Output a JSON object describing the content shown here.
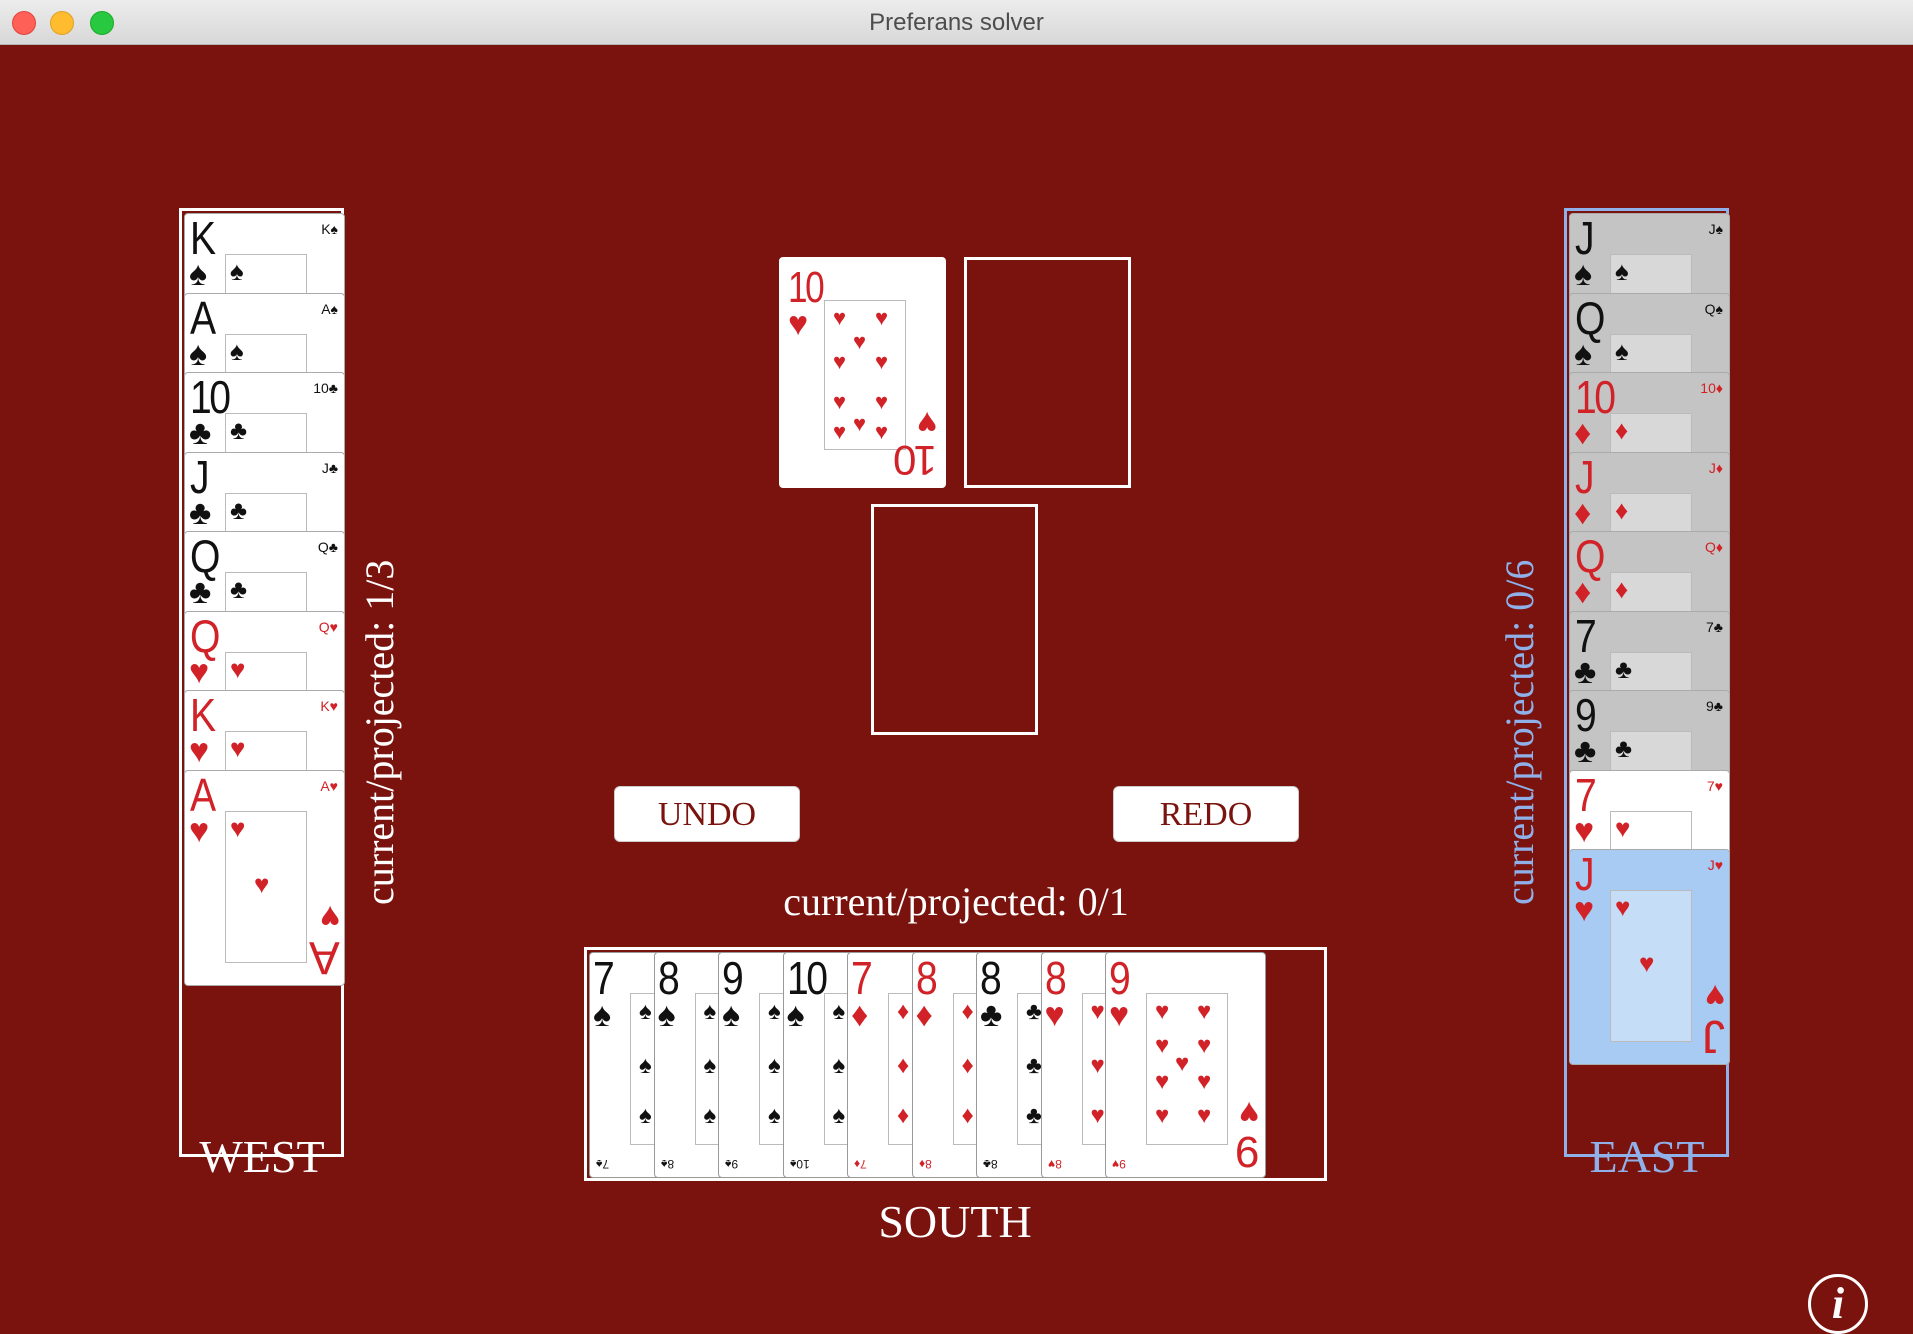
{
  "window": {
    "title": "Preferans solver"
  },
  "colors": {
    "table": "#7a130e",
    "east_accent": "#8fb0e8",
    "red_suit": "#d12228"
  },
  "west": {
    "label": "WEST",
    "score": "current/projected: 1/3",
    "cards": [
      {
        "rank": "K",
        "suit": "♠",
        "color": "black",
        "face": "K"
      },
      {
        "rank": "A",
        "suit": "♠",
        "color": "black",
        "face": "A"
      },
      {
        "rank": "10",
        "suit": "♣",
        "color": "black",
        "face": "10"
      },
      {
        "rank": "J",
        "suit": "♣",
        "color": "black",
        "face": "J"
      },
      {
        "rank": "Q",
        "suit": "♣",
        "color": "black",
        "face": "Q"
      },
      {
        "rank": "Q",
        "suit": "♥",
        "color": "red",
        "face": "Q"
      },
      {
        "rank": "K",
        "suit": "♥",
        "color": "red",
        "face": "K"
      },
      {
        "rank": "A",
        "suit": "♥",
        "color": "red",
        "face": "A"
      }
    ]
  },
  "east": {
    "label": "EAST",
    "score": "current/projected: 0/6",
    "cards": [
      {
        "rank": "J",
        "suit": "♠",
        "color": "black",
        "state": "dim"
      },
      {
        "rank": "Q",
        "suit": "♠",
        "color": "black",
        "state": "dim"
      },
      {
        "rank": "10",
        "suit": "♦",
        "color": "red",
        "state": "dim"
      },
      {
        "rank": "J",
        "suit": "♦",
        "color": "red",
        "state": "dim"
      },
      {
        "rank": "Q",
        "suit": "♦",
        "color": "red",
        "state": "dim"
      },
      {
        "rank": "7",
        "suit": "♣",
        "color": "black",
        "state": "dim"
      },
      {
        "rank": "9",
        "suit": "♣",
        "color": "black",
        "state": "dim"
      },
      {
        "rank": "7",
        "suit": "♥",
        "color": "red",
        "state": "normal"
      },
      {
        "rank": "J",
        "suit": "♥",
        "color": "red",
        "state": "selected"
      }
    ]
  },
  "south": {
    "label": "SOUTH",
    "score": "current/projected: 0/1",
    "cards": [
      {
        "rank": "7",
        "suit": "♠",
        "color": "black"
      },
      {
        "rank": "8",
        "suit": "♠",
        "color": "black"
      },
      {
        "rank": "9",
        "suit": "♠",
        "color": "black"
      },
      {
        "rank": "10",
        "suit": "♠",
        "color": "black"
      },
      {
        "rank": "7",
        "suit": "♦",
        "color": "red"
      },
      {
        "rank": "8",
        "suit": "♦",
        "color": "red"
      },
      {
        "rank": "8",
        "suit": "♣",
        "color": "black"
      },
      {
        "rank": "8",
        "suit": "♥",
        "color": "red"
      },
      {
        "rank": "9",
        "suit": "♥",
        "color": "red"
      }
    ]
  },
  "trick": {
    "west_card": {
      "rank": "10",
      "suit": "♥",
      "color": "red"
    }
  },
  "controls": {
    "undo": "UNDO",
    "redo": "REDO",
    "info": "i"
  }
}
